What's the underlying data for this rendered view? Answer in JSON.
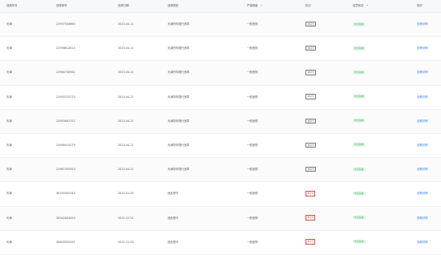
{
  "headers": {
    "col1": "违规车号",
    "col2": "违规单号",
    "col3": "违规日期",
    "col4": "违规类型",
    "col5": "严重程度",
    "col6": "扣分",
    "col7": "处罚状态",
    "col8": "操作"
  },
  "rows": [
    {
      "plate": "天津",
      "number": "22957544660",
      "date": "2023-04-11",
      "type": "天津货车限行违章",
      "severity": "一般违规",
      "points": "未扣分",
      "points_color": "#777777",
      "status": "处罚完成",
      "action": "查看详情"
    },
    {
      "plate": "天津",
      "number": "22958612814",
      "date": "2023-04-11",
      "type": "天津货车限行违章",
      "severity": "一般违规",
      "points": "未扣分",
      "points_color": "#777777",
      "status": "处罚完成",
      "action": "查看详情"
    },
    {
      "plate": "天津",
      "number": "22964740562",
      "date": "2023-04-11",
      "type": "天津货车限行违章",
      "severity": "一般违规",
      "points": "未扣分",
      "points_color": "#777777",
      "status": "处罚完成",
      "action": "查看详情"
    },
    {
      "plate": "天津",
      "number": "22955722770",
      "date": "2023-04-11",
      "type": "天津货车限行违章",
      "severity": "一般违规",
      "points": "未扣分",
      "points_color": "#777777",
      "status": "处罚完成",
      "action": "查看详情"
    },
    {
      "plate": "天津",
      "number": "22953842752",
      "date": "2023-04-11",
      "type": "天津货车限行违章",
      "severity": "一般违规",
      "points": "未扣分",
      "points_color": "#777777",
      "status": "处罚完成",
      "action": "查看详情"
    },
    {
      "plate": "天津",
      "number": "22958413279",
      "date": "2023-04-11",
      "type": "天津货车限行违章",
      "severity": "一般违规",
      "points": "未扣分",
      "points_color": "#777777",
      "status": "处罚完成",
      "action": "查看详情"
    },
    {
      "plate": "天津",
      "number": "22967355353",
      "date": "2023-04-11",
      "type": "天津货车限行违章",
      "severity": "一般违规",
      "points": "未扣分",
      "points_color": "#777777",
      "status": "处罚完成",
      "action": "查看详情"
    },
    {
      "plate": "天津",
      "number": "30740342345",
      "date": "2023-01-05",
      "type": "违反禁令",
      "severity": "一般违规",
      "points": "扣3分",
      "points_color": "#e5463e",
      "status": "处罚完成",
      "action": "查看详情"
    },
    {
      "plate": "天津",
      "number": "30942843454",
      "date": "2022-12-31",
      "type": "违反禁令",
      "severity": "一般违规",
      "points": "扣3分",
      "points_color": "#e5463e",
      "status": "处罚完成",
      "action": "查看详情"
    },
    {
      "plate": "天津",
      "number": "30893592261",
      "date": "2022-12-30",
      "type": "违反禁令",
      "severity": "一般违规",
      "points": "扣3分",
      "points_color": "#e5463e",
      "status": "处罚完成",
      "action": "查看详情"
    }
  ]
}
